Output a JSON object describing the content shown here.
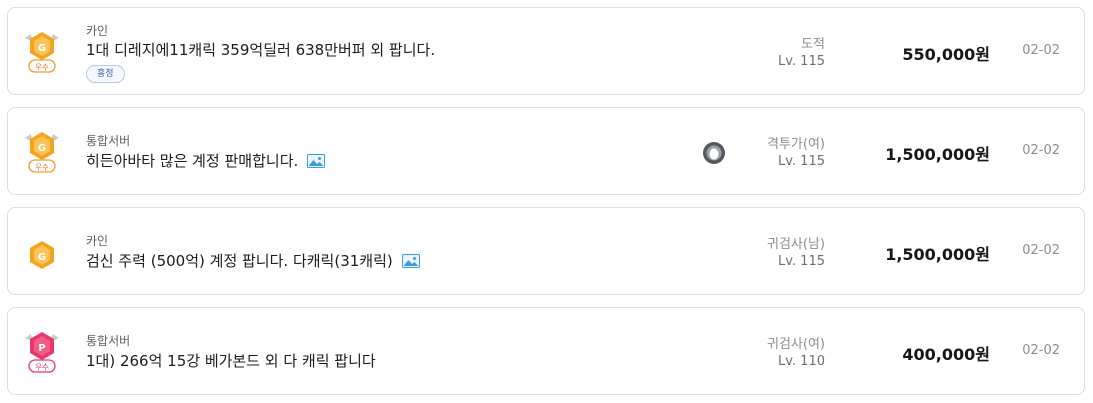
{
  "listings": [
    {
      "badge": "gold-guarantee-excellent",
      "badge_label": "우수",
      "server": "카인",
      "title": "1대 디레지에11캐릭 359억딜러 638만버퍼 외 팝니다.",
      "has_image": false,
      "tag": "흥정",
      "class_name": "도적",
      "level": "Lv. 115",
      "price": "550,000원",
      "date": "02-02"
    },
    {
      "badge": "gold-guarantee-excellent",
      "badge_label": "우수",
      "server": "통합서버",
      "title": "히든아바타 많은 계정 판매합니다.",
      "has_image": true,
      "has_avatar": true,
      "class_name": "격투가(여)",
      "level": "Lv. 115",
      "price": "1,500,000원",
      "date": "02-02"
    },
    {
      "badge": "gold-guarantee",
      "server": "카인",
      "title": "검신 주력 (500억) 계정 팝니다. 다캐릭(31캐릭)",
      "has_image": true,
      "class_name": "귀검사(남)",
      "level": "Lv. 115",
      "price": "1,500,000원",
      "date": "02-02"
    },
    {
      "badge": "power-seller-excellent",
      "badge_label": "우수",
      "server": "통합서버",
      "title": "1대) 266억 15강 베가본드 외 다 캐릭 팝니다",
      "has_image": false,
      "class_name": "귀검사(여)",
      "level": "Lv. 110",
      "price": "400,000원",
      "date": "02-02"
    }
  ],
  "colors": {
    "gold_badge": "#f7a21c",
    "pink_badge": "#e8386b",
    "image_icon": "#3a9bde",
    "tag_border": "#b9c8ea",
    "tag_text": "#3d5ea8"
  }
}
